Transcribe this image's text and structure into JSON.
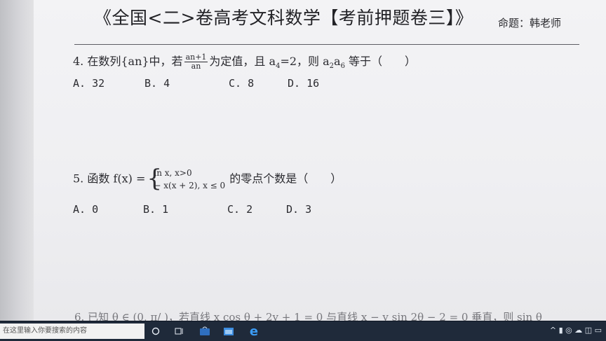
{
  "document": {
    "title": "《全国<二>卷高考文科数学【考前押题卷三】》",
    "author": "命题：韩老师",
    "q4": {
      "prefix": "4. 在数列{an}中，若",
      "frac_num": "an+1",
      "frac_den": "an",
      "suffix_1": "为定值，且 a",
      "sub_a": "4",
      "suffix_2": "=2，则 a",
      "sub_b": "2",
      "suffix_3": "a",
      "sub_c": "6",
      "suffix_4": " 等于（　　）",
      "options": [
        "A. 32",
        "B. 4",
        "C. 8",
        "D. 16"
      ]
    },
    "q5": {
      "prefix": "5. 函数 f(x) =",
      "piece_1": "ln x, x>0",
      "piece_2": "− x(x + 2), x ≤ 0",
      "suffix": "的零点个数是（　　）",
      "options": [
        "A. 0",
        "B. 1",
        "C. 2",
        "D. 3"
      ]
    },
    "q6_partial": "6. 已知 θ ∈ (0,  π/  )，若直线 x cos θ + 2y + 1 = 0 与直线 x − y sin 2θ − 2 = 0 垂直，则 sin θ"
  },
  "taskbar": {
    "search_placeholder": "在这里输入你要搜索的内容",
    "icons": [
      "task-view",
      "store",
      "edge"
    ],
    "tray_text": "^ ▮ ◎ ☁ ◫ ▭"
  }
}
